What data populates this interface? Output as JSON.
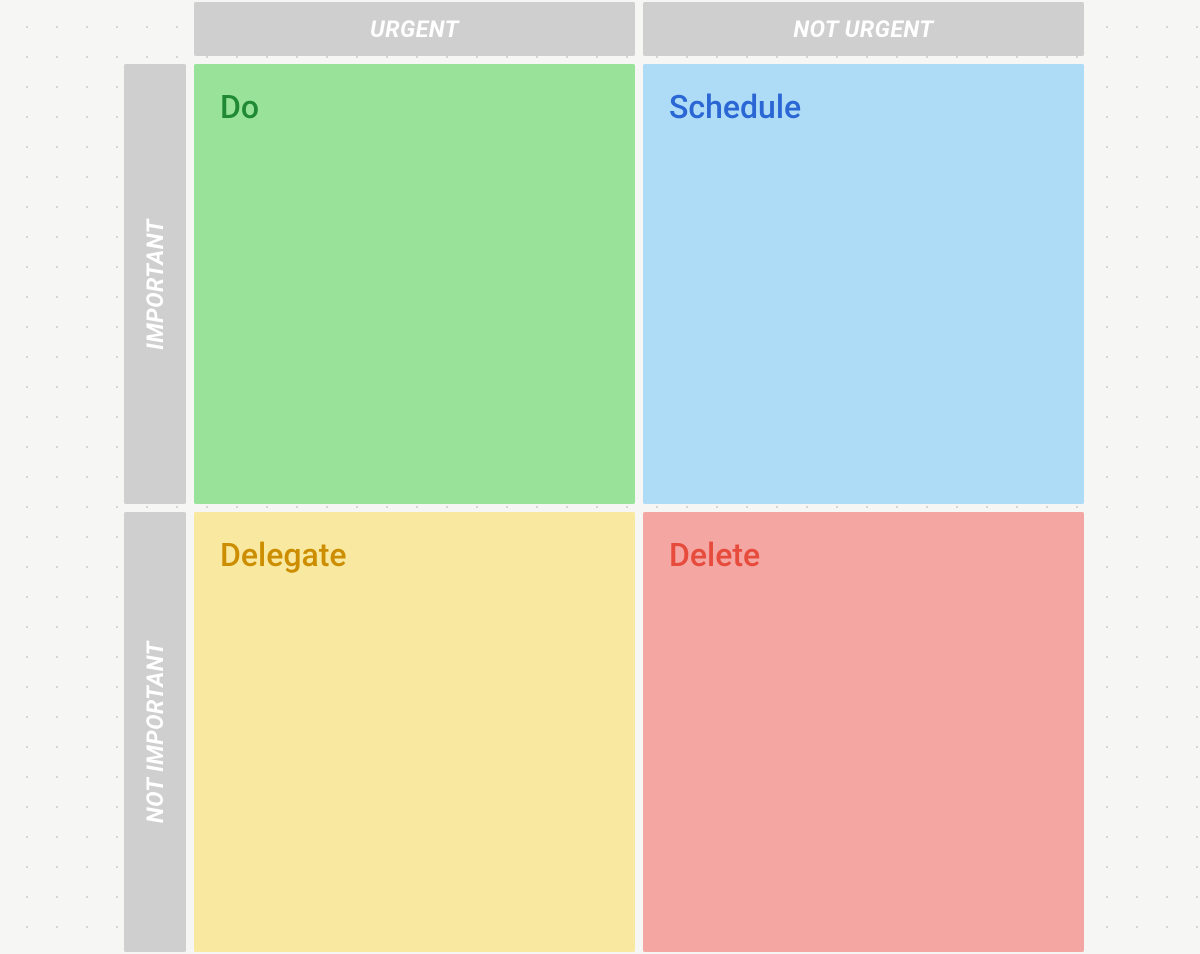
{
  "columns": {
    "urgent": "URGENT",
    "not_urgent": "NOT URGENT"
  },
  "rows": {
    "important": "IMPORTANT",
    "not_important": "NOT IMPORTANT"
  },
  "quadrants": {
    "do": {
      "title": "Do",
      "color": "#98e29a",
      "text_color": "#1f8a33"
    },
    "schedule": {
      "title": "Schedule",
      "color": "#aedbf6",
      "text_color": "#2a66d4"
    },
    "delegate": {
      "title": "Delegate",
      "color": "#f9e9a0",
      "text_color": "#cc8e00"
    },
    "delete": {
      "title": "Delete",
      "color": "#f4a6a3",
      "text_color": "#e64b3c"
    }
  }
}
